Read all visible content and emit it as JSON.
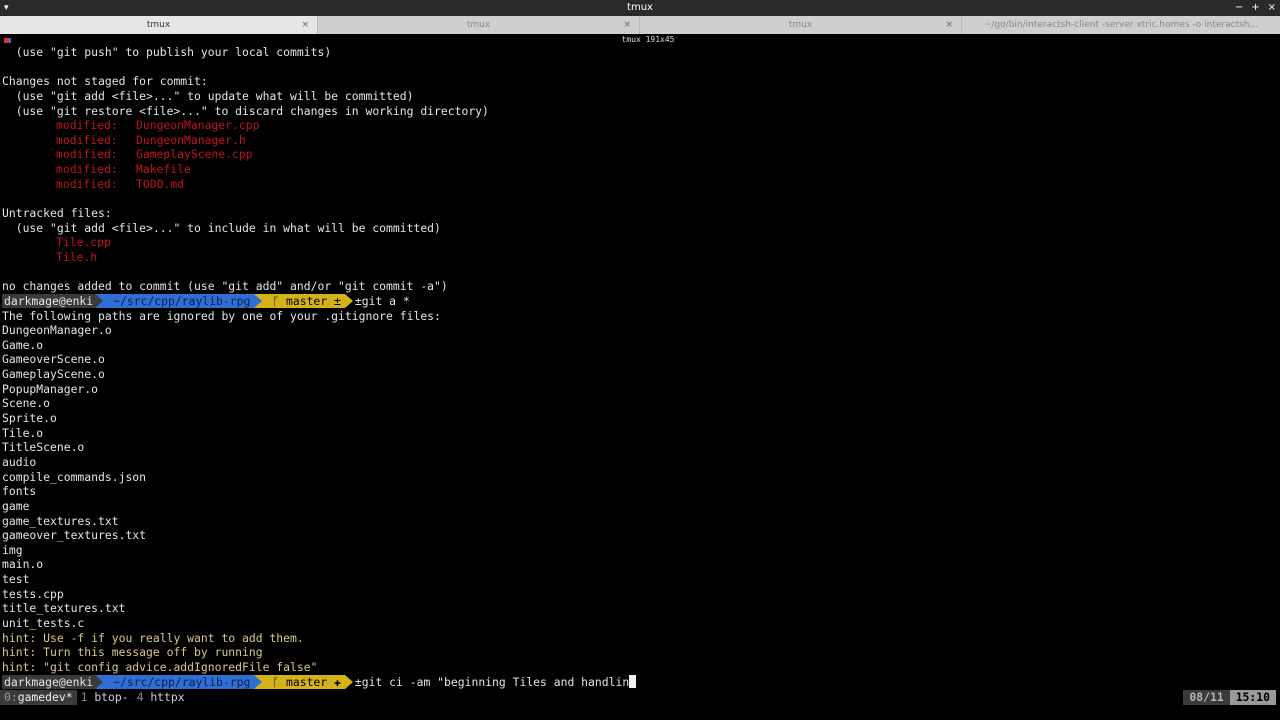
{
  "window": {
    "title": "tmux",
    "menu_icon": "chevron-down-icon",
    "controls": [
      "−",
      "+",
      "×"
    ]
  },
  "tabs": [
    {
      "label": "tmux",
      "active": true,
      "close": "×"
    },
    {
      "label": "tmux",
      "active": false,
      "close": "×"
    },
    {
      "label": "tmux",
      "active": false,
      "close": "×"
    },
    {
      "label": "~/go/bin/interactsh-client -server xtric.homes -o interactsh...",
      "active": false,
      "close": ""
    }
  ],
  "terminal": {
    "size_indicator": "tmux 191x45",
    "lines": [
      {
        "text": "  (use \"git push\" to publish your local commits)",
        "kind": "plain"
      },
      {
        "text": "",
        "kind": "plain"
      },
      {
        "text": "Changes not staged for commit:",
        "kind": "plain"
      },
      {
        "text": "  (use \"git add <file>...\" to update what will be committed)",
        "kind": "plain"
      },
      {
        "text": "  (use \"git restore <file>...\" to discard changes in working directory)",
        "kind": "plain"
      },
      {
        "label": "modified:",
        "text": "DungeonManager.cpp",
        "kind": "mod"
      },
      {
        "label": "modified:",
        "text": "DungeonManager.h",
        "kind": "mod"
      },
      {
        "label": "modified:",
        "text": "GameplayScene.cpp",
        "kind": "mod"
      },
      {
        "label": "modified:",
        "text": "Makefile",
        "kind": "mod"
      },
      {
        "label": "modified:",
        "text": "TODO.md",
        "kind": "mod"
      },
      {
        "text": "",
        "kind": "plain"
      },
      {
        "text": "Untracked files:",
        "kind": "plain"
      },
      {
        "text": "  (use \"git add <file>...\" to include in what will be committed)",
        "kind": "plain"
      },
      {
        "text": "Tile.cpp",
        "kind": "untracked"
      },
      {
        "text": "Tile.h",
        "kind": "untracked"
      },
      {
        "text": "",
        "kind": "plain"
      },
      {
        "text": "no changes added to commit (use \"git add\" and/or \"git commit -a\")",
        "kind": "plain"
      },
      {
        "kind": "prompt",
        "user": "darkmage@enki",
        "path": "~/src/cpp/raylib-rpg",
        "branch": "ᚴ master ±",
        "cmd": "±git a *"
      },
      {
        "text": "The following paths are ignored by one of your .gitignore files:",
        "kind": "plain"
      },
      {
        "text": "DungeonManager.o",
        "kind": "plain"
      },
      {
        "text": "Game.o",
        "kind": "plain"
      },
      {
        "text": "GameoverScene.o",
        "kind": "plain"
      },
      {
        "text": "GameplayScene.o",
        "kind": "plain"
      },
      {
        "text": "PopupManager.o",
        "kind": "plain"
      },
      {
        "text": "Scene.o",
        "kind": "plain"
      },
      {
        "text": "Sprite.o",
        "kind": "plain"
      },
      {
        "text": "Tile.o",
        "kind": "plain"
      },
      {
        "text": "TitleScene.o",
        "kind": "plain"
      },
      {
        "text": "audio",
        "kind": "plain"
      },
      {
        "text": "compile_commands.json",
        "kind": "plain"
      },
      {
        "text": "fonts",
        "kind": "plain"
      },
      {
        "text": "game",
        "kind": "plain"
      },
      {
        "text": "game_textures.txt",
        "kind": "plain"
      },
      {
        "text": "gameover_textures.txt",
        "kind": "plain"
      },
      {
        "text": "img",
        "kind": "plain"
      },
      {
        "text": "main.o",
        "kind": "plain"
      },
      {
        "text": "test",
        "kind": "plain"
      },
      {
        "text": "tests.cpp",
        "kind": "plain"
      },
      {
        "text": "title_textures.txt",
        "kind": "plain"
      },
      {
        "text": "unit_tests.c",
        "kind": "plain"
      },
      {
        "text": "hint: Use -f if you really want to add them.",
        "kind": "hint"
      },
      {
        "text": "hint: Turn this message off by running",
        "kind": "hint"
      },
      {
        "text": "hint: \"git config advice.addIgnoredFile false\"",
        "kind": "hint"
      },
      {
        "kind": "prompt",
        "user": "darkmage@enki",
        "path": "~/src/cpp/raylib-rpg",
        "branch": "ᚴ master ✚",
        "cmd": "±git ci -am \"beginning Tiles and handlin",
        "cursor": true
      }
    ]
  },
  "statusbar": {
    "windows": [
      {
        "index": "0:",
        "name": "gamedev*",
        "current": true
      },
      {
        "index": "1",
        "name": "btop-",
        "current": false
      },
      {
        "index": "4",
        "name": "httpx",
        "current": false
      }
    ],
    "date": "08/11",
    "time": "15:10"
  }
}
